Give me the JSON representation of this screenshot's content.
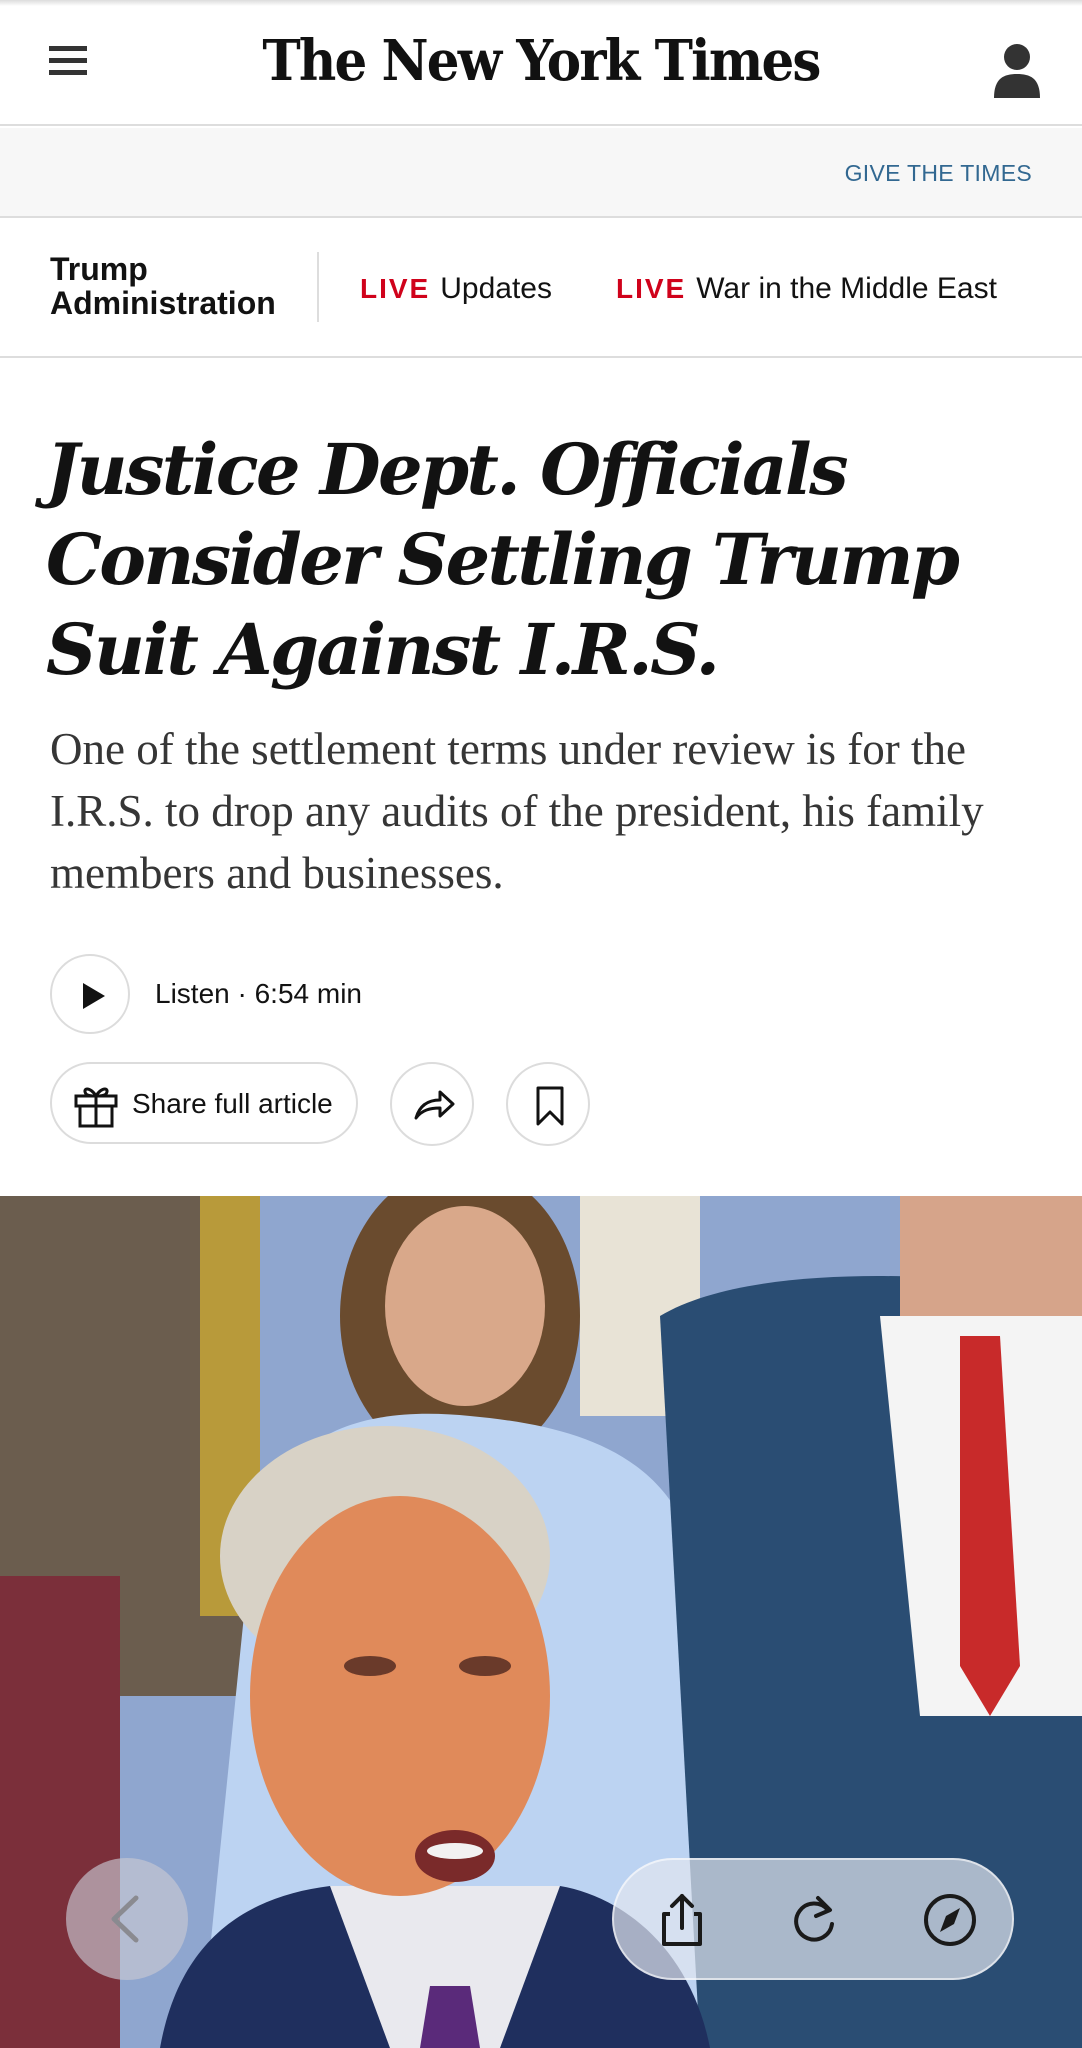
{
  "masthead": {
    "logo": "The New York Times",
    "menu_icon": "hamburger-menu-icon",
    "account_icon": "person-icon"
  },
  "promo": {
    "give_link": "GIVE THE TIMES"
  },
  "live_nav": {
    "section": "Trump Administration",
    "items": [
      {
        "live": "LIVE",
        "label": "Updates"
      },
      {
        "live": "LIVE",
        "label": "War in the Middle East"
      }
    ]
  },
  "article": {
    "headline": "Justice Dept. Officials Consider Settling Trump Suit Against I.R.S.",
    "summary": "One of the settlement terms under review is for the I.R.S. to drop any audits of the president, his family members and businesses.",
    "listen_label": "Listen · 6:54 min",
    "share_label": "Share full article"
  },
  "browser_controls": {
    "icons": [
      "back-chevron-icon",
      "share-icon",
      "reload-icon",
      "compass-icon"
    ]
  },
  "colors": {
    "live_red": "#d0021b",
    "link_blue": "#326891",
    "text": "#121212"
  }
}
